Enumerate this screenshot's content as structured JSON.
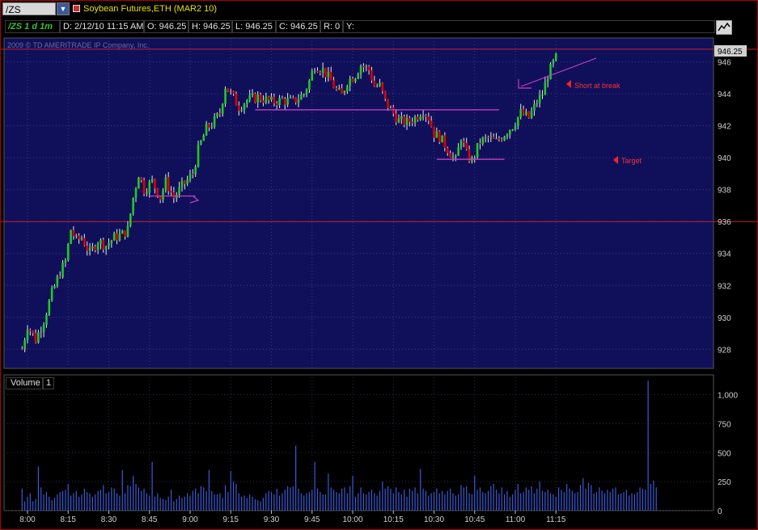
{
  "header": {
    "symbol": "/ZS",
    "instrument": "Soybean Futures,ETH (MAR2 10)"
  },
  "info": {
    "period": "/ZS 1 d 1m",
    "date": "D: 2/12/10 11:15 AM",
    "open": "O: 946.25",
    "high": "H: 946.25",
    "low": "L: 946.25",
    "close": "C: 946.25",
    "range": "R: 0",
    "y": "Y:"
  },
  "watermark": "2009 © TD AMERITRADE IP Company, Inc.",
  "last_price_tag": "946.25",
  "volume_label": "Volume",
  "volume_index": "1",
  "annotations": {
    "short": "Short at break",
    "target": "Target"
  },
  "colors": {
    "panel_bg": "#10105a",
    "up": "#22c822",
    "down": "#e00000",
    "annotation": "#c040c0",
    "annotation_text": "#ff3030",
    "volume": "#3a5ad8",
    "reference_line": "#c82020"
  },
  "chart_data": [
    {
      "type": "candlestick",
      "title": "Soybean Futures,ETH (MAR2 10)",
      "interval": "1m",
      "x_ticks": [
        "8:00",
        "8:15",
        "8:30",
        "8:45",
        "9:00",
        "9:15",
        "9:30",
        "9:45",
        "10:00",
        "10:15",
        "10:30",
        "10:45",
        "11:00",
        "11:15"
      ],
      "y_ticks": [
        "928",
        "930",
        "932",
        "934",
        "936",
        "938",
        "940",
        "942",
        "944",
        "946"
      ],
      "ylim": [
        926.8,
        947.5
      ],
      "grid": true,
      "reference_lines": [
        936,
        946.8
      ],
      "support_resistance": [
        {
          "level": 937.6,
          "from": "8:45",
          "to": "9:02"
        },
        {
          "level": 943.0,
          "from": "9:24",
          "to": "10:54"
        },
        {
          "level": 939.9,
          "from": "10:31",
          "to": "10:56"
        }
      ],
      "path": [
        [
          "7:58",
          928.0
        ],
        [
          "8:00",
          929.5
        ],
        [
          "8:03",
          928.6
        ],
        [
          "8:06",
          929.8
        ],
        [
          "8:09",
          931.5
        ],
        [
          "8:12",
          932.8
        ],
        [
          "8:14",
          933.5
        ],
        [
          "8:16",
          935.5
        ],
        [
          "8:18",
          934.8
        ],
        [
          "8:20",
          935.0
        ],
        [
          "8:23",
          934.0
        ],
        [
          "8:26",
          934.8
        ],
        [
          "8:29",
          934.5
        ],
        [
          "8:32",
          935.0
        ],
        [
          "8:35",
          935.2
        ],
        [
          "8:37",
          935.5
        ],
        [
          "8:39",
          937.5
        ],
        [
          "8:41",
          939.0
        ],
        [
          "8:43",
          938.0
        ],
        [
          "8:46",
          938.5
        ],
        [
          "8:49",
          937.5
        ],
        [
          "8:51",
          938.5
        ],
        [
          "8:54",
          937.5
        ],
        [
          "8:57",
          938.2
        ],
        [
          "8:59",
          938.6
        ],
        [
          "9:01",
          939.0
        ],
        [
          "9:03",
          940.5
        ],
        [
          "9:06",
          941.8
        ],
        [
          "9:09",
          942.3
        ],
        [
          "9:11",
          942.8
        ],
        [
          "9:13",
          944.5
        ],
        [
          "9:15",
          944.0
        ],
        [
          "9:18",
          943.2
        ],
        [
          "9:21",
          943.6
        ],
        [
          "9:25",
          943.8
        ],
        [
          "9:30",
          943.5
        ],
        [
          "9:34",
          943.6
        ],
        [
          "9:38",
          943.5
        ],
        [
          "9:42",
          944.0
        ],
        [
          "9:44",
          944.8
        ],
        [
          "9:46",
          945.8
        ],
        [
          "9:49",
          945.5
        ],
        [
          "9:52",
          944.8
        ],
        [
          "9:54",
          944.2
        ],
        [
          "9:56",
          943.9
        ],
        [
          "9:58",
          944.8
        ],
        [
          "10:01",
          945.2
        ],
        [
          "10:03",
          945.8
        ],
        [
          "10:06",
          945.5
        ],
        [
          "10:08",
          944.5
        ],
        [
          "10:10",
          944.5
        ],
        [
          "10:12",
          943.5
        ],
        [
          "10:14",
          943.0
        ],
        [
          "10:17",
          942.3
        ],
        [
          "10:20",
          942.2
        ],
        [
          "10:23",
          942.5
        ],
        [
          "10:26",
          943.0
        ],
        [
          "10:28",
          942.5
        ],
        [
          "10:30",
          941.5
        ],
        [
          "10:32",
          941.3
        ],
        [
          "10:34",
          940.8
        ],
        [
          "10:36",
          940.3
        ],
        [
          "10:38",
          939.8
        ],
        [
          "10:40",
          941.3
        ],
        [
          "10:42",
          940.2
        ],
        [
          "10:44",
          939.8
        ],
        [
          "10:47",
          941.0
        ],
        [
          "10:50",
          941.2
        ],
        [
          "10:53",
          941.0
        ],
        [
          "10:56",
          941.5
        ],
        [
          "10:59",
          942.0
        ],
        [
          "11:02",
          942.8
        ],
        [
          "11:05",
          942.5
        ],
        [
          "11:08",
          943.5
        ],
        [
          "11:10",
          944.0
        ],
        [
          "11:12",
          945.2
        ],
        [
          "11:15",
          946.25
        ]
      ]
    },
    {
      "type": "bar",
      "title": "Volume",
      "y_ticks": [
        "0",
        "250",
        "500",
        "750",
        "1,000"
      ],
      "ylim": [
        0,
        1150
      ],
      "values": [
        190,
        80,
        120,
        150,
        80,
        100,
        380,
        200,
        140,
        160,
        120,
        90,
        110,
        140,
        160,
        170,
        180,
        230,
        130,
        150,
        170,
        120,
        140,
        190,
        160,
        150,
        120,
        140,
        170,
        180,
        220,
        150,
        160,
        200,
        190,
        150,
        130,
        350,
        150,
        220,
        210,
        300,
        230,
        200,
        170,
        190,
        150,
        130,
        420,
        120,
        150,
        110,
        100,
        90,
        120,
        180,
        80,
        100,
        130,
        110,
        120,
        150,
        130,
        170,
        190,
        150,
        210,
        200,
        170,
        350,
        170,
        140,
        140,
        150,
        110,
        220,
        160,
        340,
        250,
        230,
        150,
        120,
        130,
        110,
        140,
        120,
        100,
        90,
        80,
        110,
        150,
        170,
        160,
        140,
        190,
        130,
        150,
        180,
        210,
        200,
        210,
        560,
        190,
        150,
        130,
        150,
        160,
        180,
        420,
        190,
        160,
        140,
        140,
        320,
        200,
        180,
        160,
        150,
        190,
        200,
        150,
        210,
        300,
        120,
        150,
        200,
        150,
        140,
        160,
        180,
        150,
        130,
        170,
        250,
        190,
        210,
        190,
        150,
        200,
        160,
        140,
        180,
        120,
        190,
        170,
        200,
        150,
        360,
        190,
        170,
        130,
        150,
        160,
        190,
        150,
        170,
        140,
        170,
        190,
        150,
        130,
        140,
        220,
        200,
        210,
        150,
        140,
        300,
        180,
        200,
        160,
        150,
        170,
        210,
        230,
        180,
        150,
        200,
        140,
        170,
        120,
        140,
        180,
        230,
        150,
        160,
        200,
        180,
        210,
        150,
        190,
        250,
        170,
        160,
        180,
        150,
        140,
        120,
        200,
        180,
        160,
        230,
        190,
        170,
        150,
        160,
        220,
        280,
        190,
        240,
        220,
        150,
        160,
        200,
        170,
        150,
        180,
        160,
        190,
        200,
        140,
        150,
        160,
        180,
        130,
        150,
        140,
        160,
        200,
        190,
        180,
        1120,
        230,
        260,
        200
      ]
    }
  ]
}
